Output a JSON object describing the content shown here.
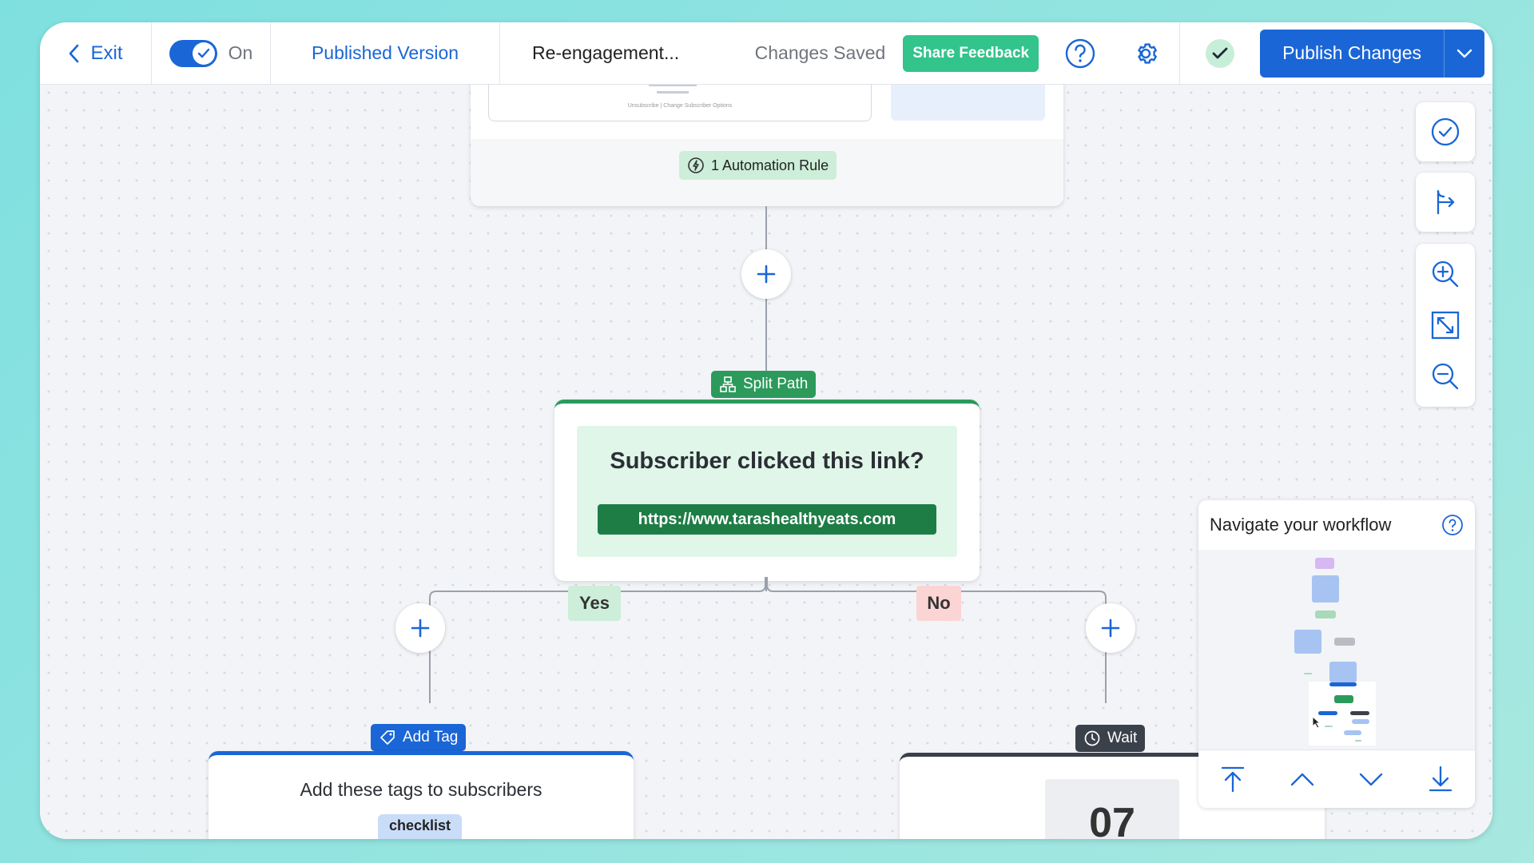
{
  "topbar": {
    "exit_label": "Exit",
    "toggle_label": "On",
    "published_label": "Published Version",
    "workflow_title": "Re-engagement...",
    "status_text": "Changes Saved",
    "feedback_label": "Share Feedback",
    "publish_label": "Publish Changes"
  },
  "email_node": {
    "footer_text_1": "Unsubscribe  |  Change Subscriber Options",
    "automation_label": "1 Automation Rule"
  },
  "split_node": {
    "badge_label": "Split Path",
    "question": "Subscriber clicked this link?",
    "link": "https://www.tarashealthyeats.com",
    "yes_label": "Yes",
    "no_label": "No"
  },
  "tag_node": {
    "badge_label": "Add Tag",
    "title": "Add these tags to subscribers",
    "tag_chip": "checklist"
  },
  "wait_node": {
    "badge_label": "Wait",
    "value": "07"
  },
  "navigator": {
    "title": "Navigate your workflow"
  },
  "colors": {
    "primary": "#1a66d6",
    "green": "#2c9a5b",
    "dark_green": "#1e7d45",
    "feedback": "#32c48a",
    "wait": "#3a414b"
  }
}
